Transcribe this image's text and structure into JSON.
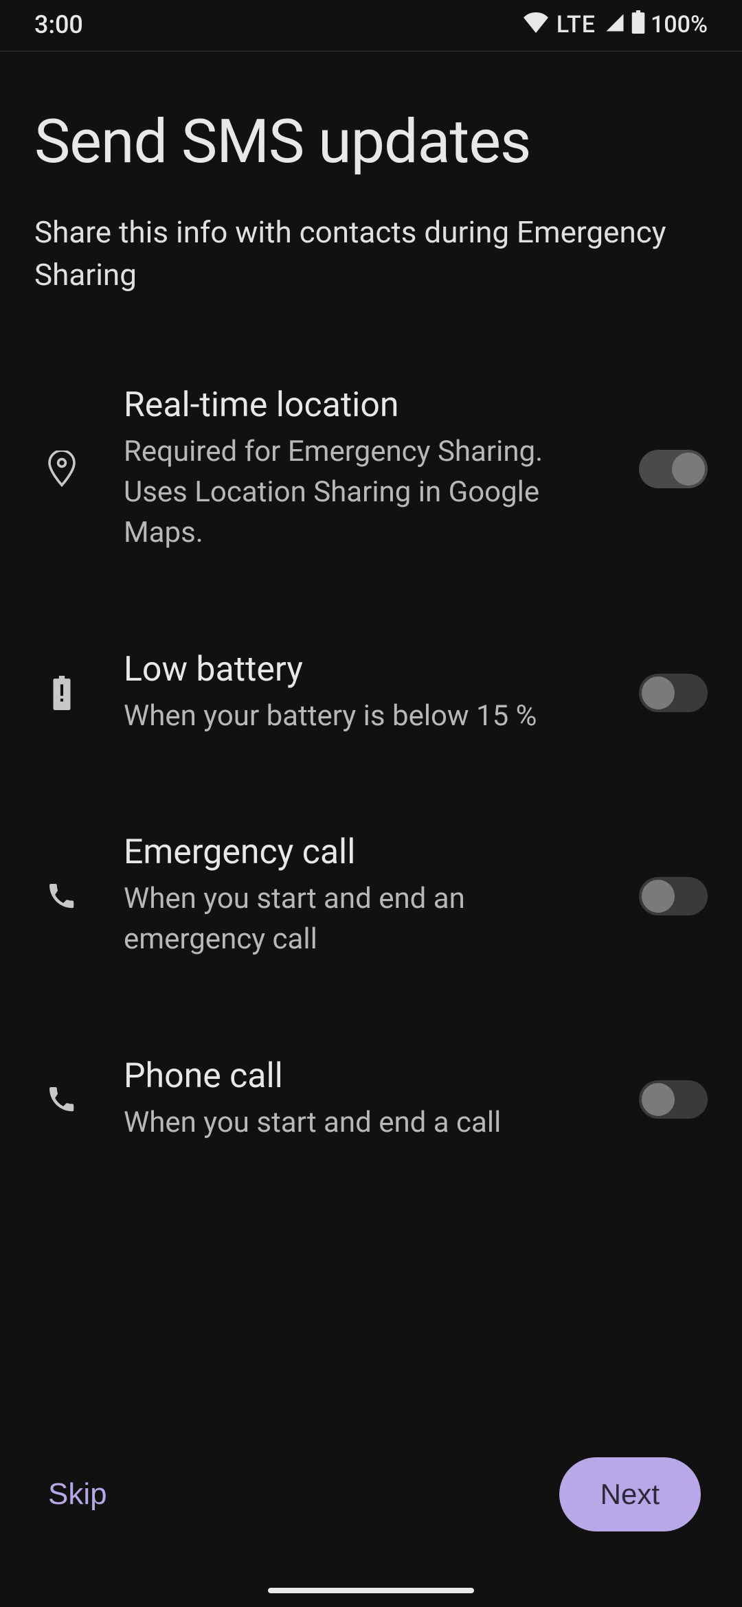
{
  "statusbar": {
    "time": "3:00",
    "lte": "LTE",
    "battery": "100%"
  },
  "header": {
    "title": "Send SMS updates",
    "subtitle": "Share this info with contacts during Emergency Sharing"
  },
  "options": [
    {
      "title": "Real-time location",
      "desc": "Required for Emergency Sharing. Uses Location Sharing in Google Maps.",
      "enabled": true,
      "locked": true
    },
    {
      "title": "Low battery",
      "desc": "When your battery is below 15 %",
      "enabled": false,
      "locked": false
    },
    {
      "title": "Emergency call",
      "desc": "When you start and end an emergency call",
      "enabled": false,
      "locked": false
    },
    {
      "title": "Phone call",
      "desc": "When you start and end a call",
      "enabled": false,
      "locked": false
    }
  ],
  "footer": {
    "skip": "Skip",
    "next": "Next"
  }
}
